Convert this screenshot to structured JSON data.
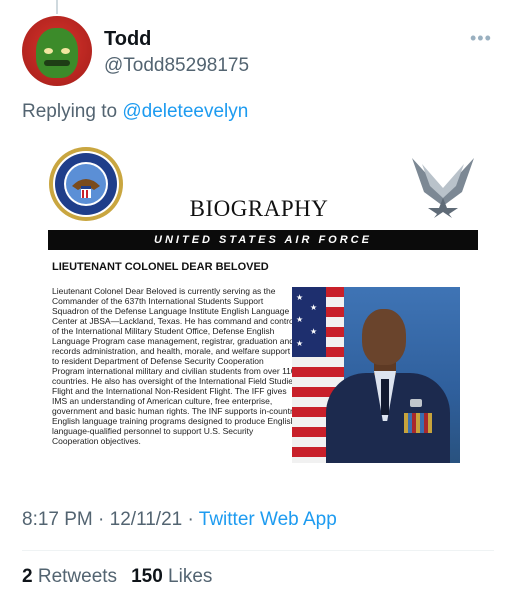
{
  "tweet": {
    "display_name": "Todd",
    "handle": "@Todd85298175",
    "more_icon": "•••",
    "replying_prefix": "Replying to ",
    "replying_to": "@deleteevelyn",
    "time": "8:17 PM",
    "sep1": " · ",
    "date": "12/11/21",
    "sep2": " · ",
    "app": "Twitter Web App",
    "retweet_count": "2",
    "retweet_label": "Retweets",
    "like_count": "150",
    "like_label": "Likes"
  },
  "media": {
    "seal_icon": "dept-of-air-force-seal-icon",
    "wings_icon": "air-force-symbol-icon",
    "title": "BIOGRAPHY",
    "banner": "UNITED STATES AIR FORCE",
    "person": "LIEUTENANT COLONEL DEAR BELOVED",
    "body": "Lieutenant Colonel Dear Beloved is currently serving as the Commander of the 637th International Students Support Squadron of the Defense Language Institute English Language Center at JBSA—Lackland, Texas. He has command and control of the International Military Student Office, Defense English Language Program case management, registrar, graduation and records administration, and health, morale, and welfare support to resident Department of Defense Security Cooperation Program international military and civilian students from over 110 countries. He also has oversight of the International Field Studies Flight and the International Non-Resident Flight. The IFF gives IMS an understanding of American culture, free enterprise, government and basic human rights. The INF supports in-country English language training programs designed to produce English language-qualified personnel to support U.S. Security Cooperation objectives."
  },
  "colors": {
    "link": "#1d9bf0",
    "secondary_text": "#536471",
    "primary_text": "#0f1419",
    "banner_bg": "#0b0b0b"
  }
}
